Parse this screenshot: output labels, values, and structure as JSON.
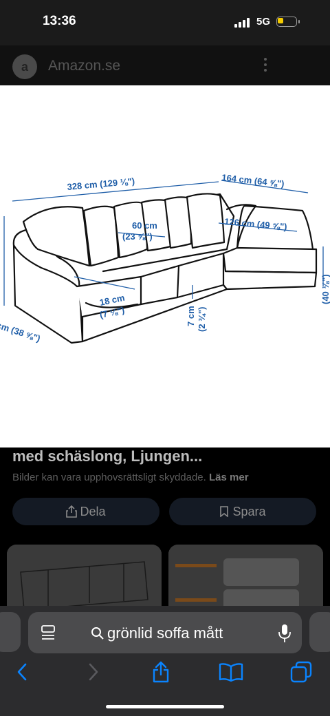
{
  "status_bar": {
    "time": "13:36",
    "network": "5G",
    "signal_bars": 4,
    "battery_level": 0.35,
    "battery_color": "#f5cc00"
  },
  "header": {
    "site_name": "Amazon.se",
    "site_icon": "amazon-logo"
  },
  "image": {
    "dimensions": [
      "328 cm (129 ⅛\")",
      "164 cm (64 ⅝\")",
      "60 cm",
      "(23 ⅝\")",
      "126 cm (49 ⅝\")",
      "18 cm",
      "(7 ⅛\")",
      "7 cm",
      "(2 ¾\")",
      "cm (38 ⅝\")",
      "(40 ⅛\")"
    ]
  },
  "result": {
    "caption": "med schäslong, Ljungen...",
    "copyright": "Bilder kan vara upphovsrättsligt skyddade.",
    "read_more": "Läs mer",
    "share_label": "Dela",
    "save_label": "Spara"
  },
  "toolbar": {
    "search_text": "grönlid soffa mått",
    "icons": [
      "back-icon",
      "forward-icon",
      "share-icon",
      "bookmarks-icon",
      "tabs-icon"
    ],
    "accent": "#0a84ff"
  }
}
